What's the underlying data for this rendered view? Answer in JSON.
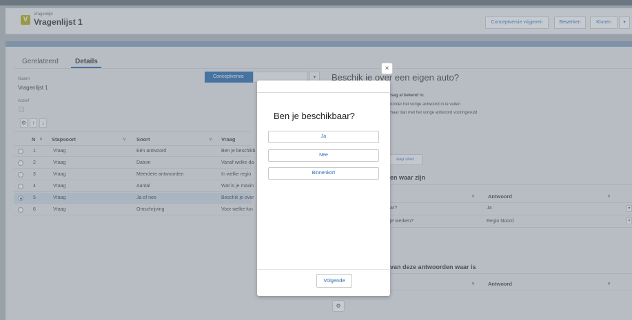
{
  "header": {
    "object_label": "Vragenlijst",
    "title": "Vragenlijst 1",
    "app_icon": "V",
    "buttons": {
      "release": "Conceptversie vrijgeven",
      "edit": "Bewerken",
      "clone": "Klonen",
      "more": "▾"
    }
  },
  "tabs": {
    "related": "Gerelateerd",
    "details": "Details"
  },
  "details": {
    "name_label": "Naam",
    "name_value": "Vragenlijst 1",
    "active_label": "Actief"
  },
  "toolbar": {
    "settings": "⚙",
    "up": "↑",
    "down": "↓"
  },
  "grid": {
    "columns": {
      "n": "N",
      "step_type": "Stapsoort",
      "kind": "Soort",
      "question": "Vraag"
    },
    "rows": [
      {
        "n": "1",
        "step_type": "Vraag",
        "kind": "Eén antwoord",
        "question": "Ben je beschikb"
      },
      {
        "n": "2",
        "step_type": "Vraag",
        "kind": "Datum",
        "question": "Vanaf welke da"
      },
      {
        "n": "3",
        "step_type": "Vraag",
        "kind": "Meerdere antwoorden",
        "question": "In welke regio"
      },
      {
        "n": "4",
        "step_type": "Vraag",
        "kind": "Aantal",
        "question": "Wat is je maxin"
      },
      {
        "n": "5",
        "step_type": "Vraag",
        "kind": "Ja of nee",
        "question": "Beschik je over"
      },
      {
        "n": "6",
        "step_type": "Vraag",
        "kind": "Omschrijving",
        "question": "Voor welke fun"
      }
    ]
  },
  "status": {
    "current": "Conceptversie",
    "dropdown_caret": "▾"
  },
  "right": {
    "title_visible": "Beschik je over een eigen auto?",
    "note_bold": "rsag al bekend is:",
    "note_1": "zonder het vorige antwoord in te vullen",
    "note_2": "maar dan met het vorige antwoord vooringevuld",
    "skip_button": "stap over",
    "section_1": "en waar zijn",
    "answer_header": "Antwoord",
    "rows": [
      {
        "question": "ar?",
        "answer": "Ja"
      },
      {
        "question": "je werken?",
        "answer": "Regio Noord"
      }
    ],
    "section_2": "van deze antwoorden waar is",
    "add_icon": "⚙"
  },
  "modal": {
    "question": "Ben je beschikbaar?",
    "options": [
      "Ja",
      "Nee",
      "Binnenkort"
    ],
    "next_button": "Volgende",
    "close": "×"
  }
}
